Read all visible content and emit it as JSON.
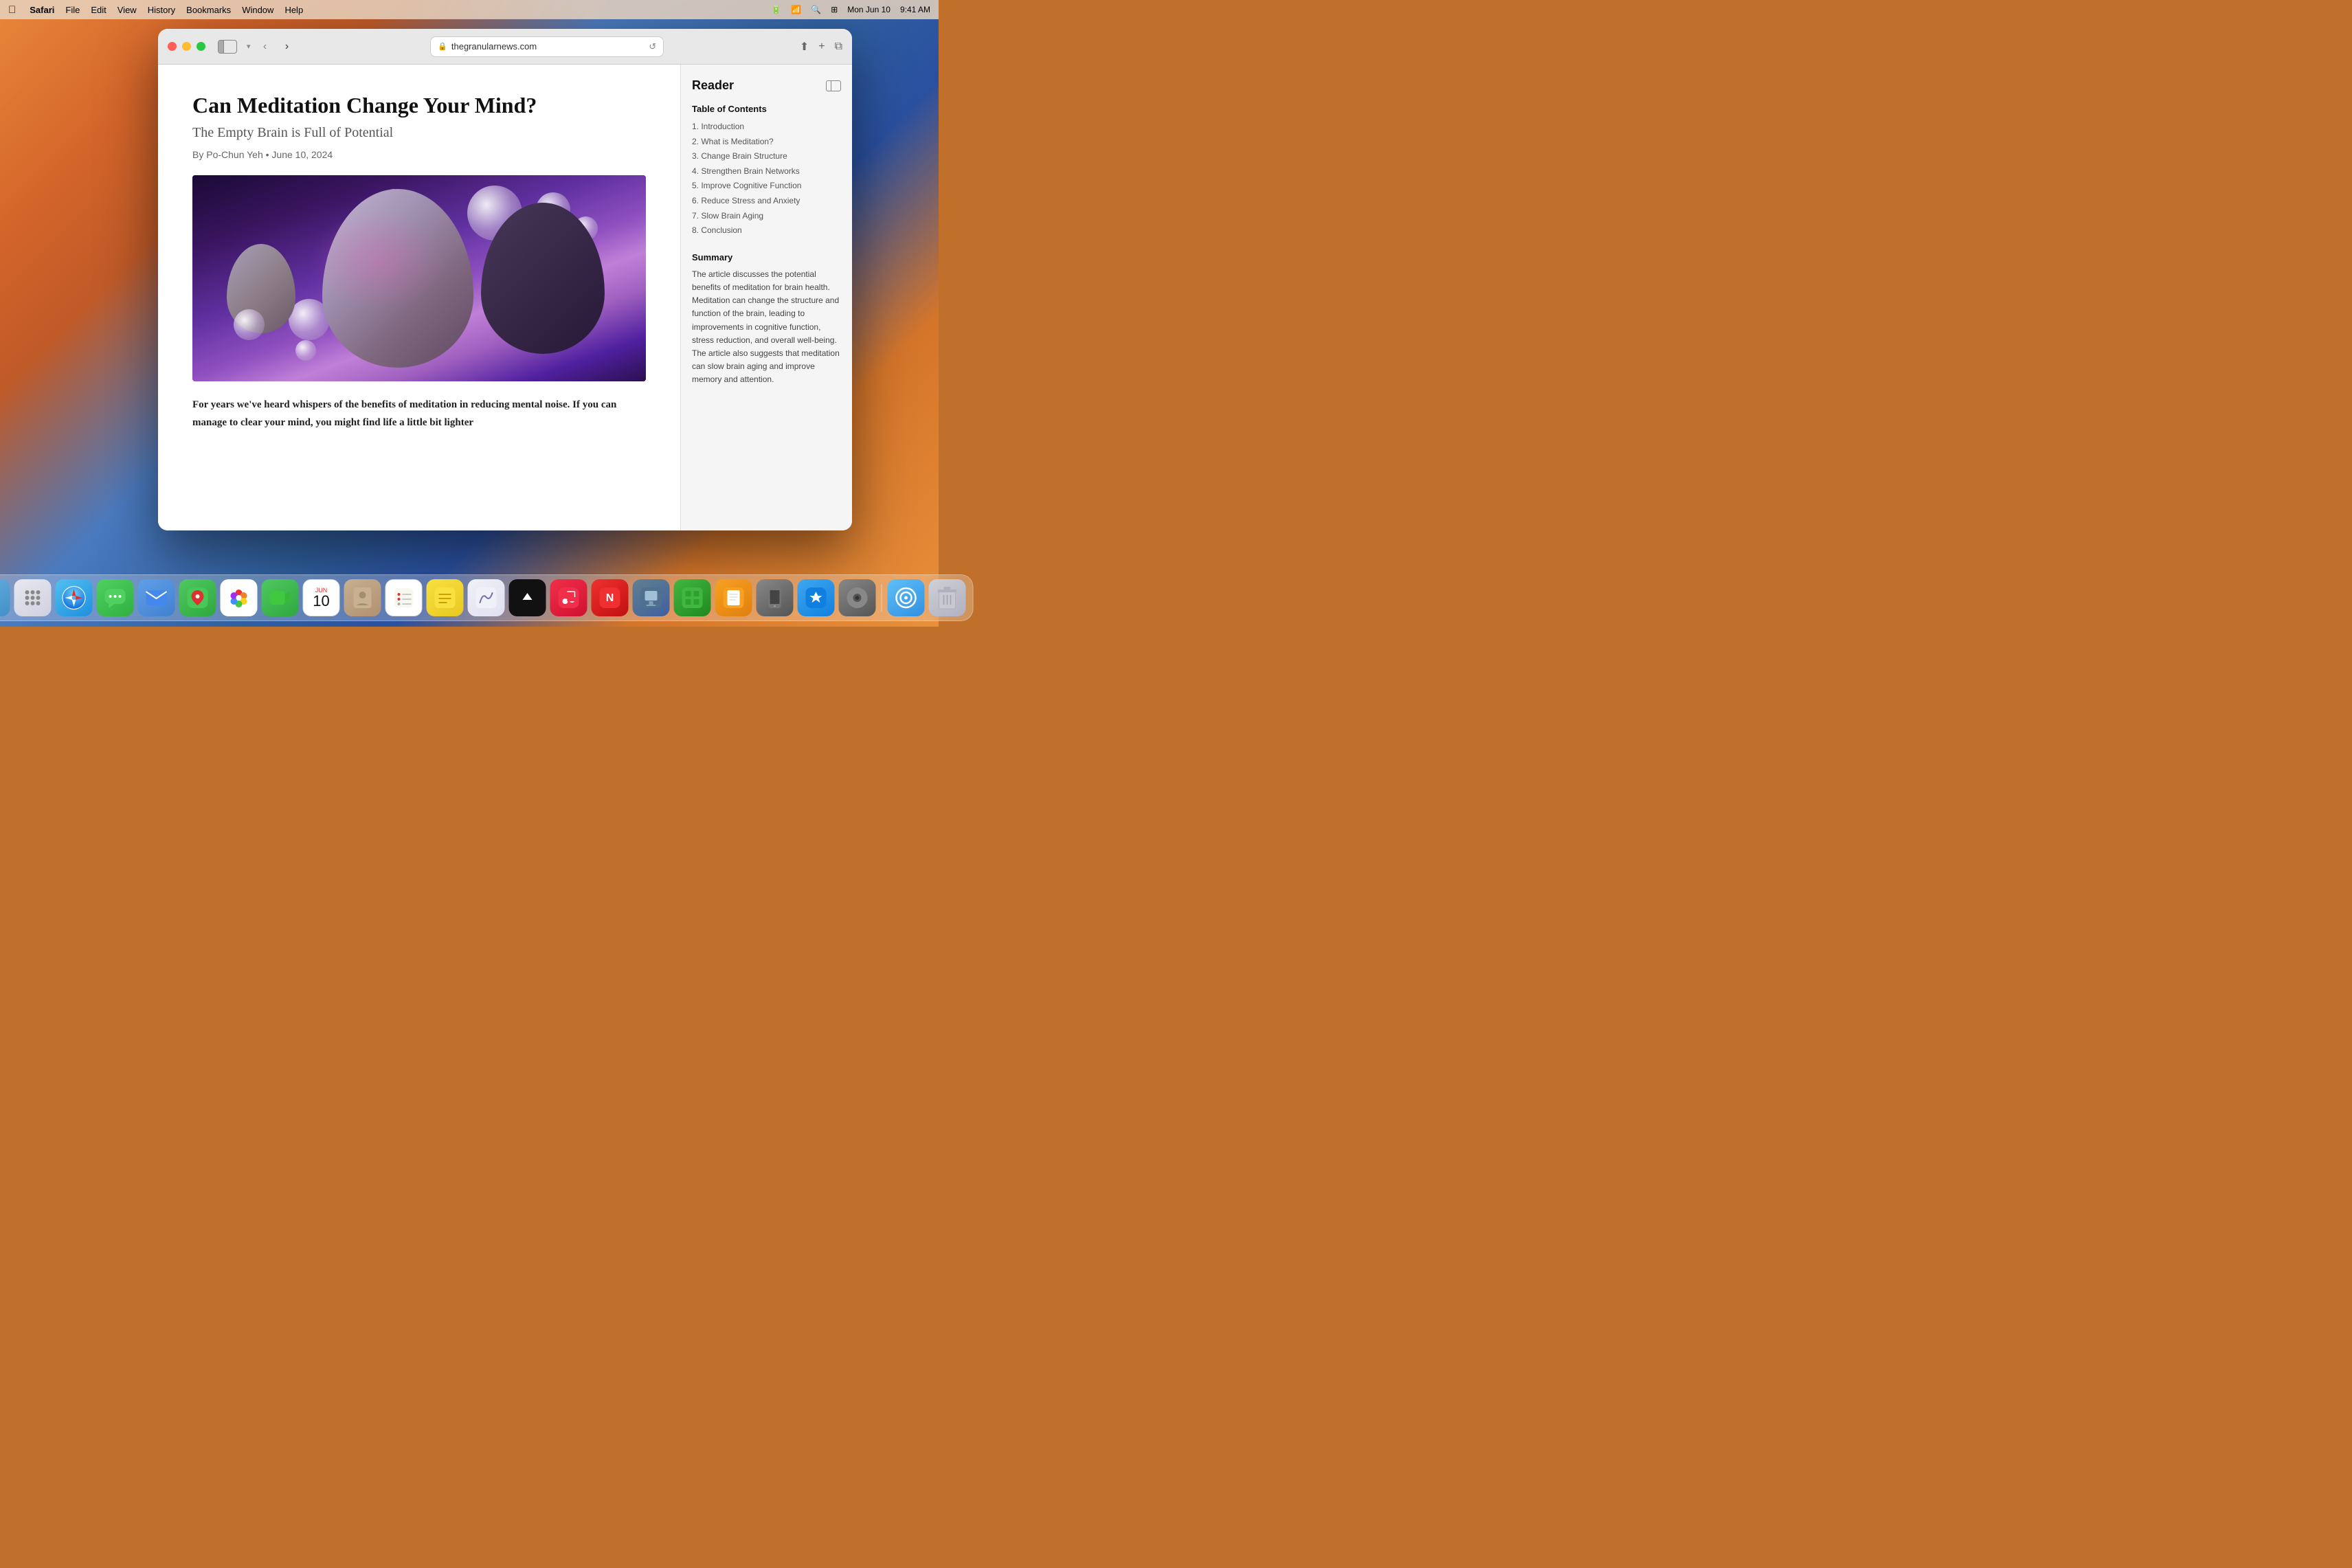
{
  "desktop": {
    "time": "9:41 AM",
    "date": "Mon Jun 10"
  },
  "menubar": {
    "apple": "🍎",
    "items": [
      "Safari",
      "File",
      "Edit",
      "View",
      "History",
      "Bookmarks",
      "Window",
      "Help"
    ]
  },
  "safari": {
    "url": "thegranularnews.com",
    "reader_label": "Reader",
    "toolbar": {
      "back": "‹",
      "forward": "›",
      "share": "⬆",
      "new_tab": "+",
      "tab_overview": "⧉",
      "reload": "↺"
    }
  },
  "article": {
    "title": "Can Meditation Change Your Mind?",
    "subtitle": "The Empty Brain is Full of Potential",
    "byline": "By Po-Chun Yeh  •  June 10, 2024",
    "body_start": "For years we've heard whispers of the benefits of meditation in reducing mental noise. If you can manage to clear your mind, you might find life a little bit lighter"
  },
  "reader": {
    "title": "Reader",
    "toc_title": "Table of Contents",
    "toc_items": [
      "1. Introduction",
      "2. What is Meditation?",
      "3. Change Brain Structure",
      "4. Strengthen Brain Networks",
      "5. Improve Cognitive Function",
      "6. Reduce Stress and Anxiety",
      "7. Slow Brain Aging",
      "8. Conclusion"
    ],
    "summary_title": "Summary",
    "summary_text": "The article discusses the potential benefits of meditation for brain health. Meditation can change the structure and function of the brain, leading to improvements in cognitive function, stress reduction, and overall well-being. The article also suggests that meditation can slow brain aging and improve memory and attention."
  },
  "dock": {
    "calendar_month": "JUN",
    "calendar_day": "10",
    "apps": [
      {
        "name": "Finder",
        "class": "dock-finder"
      },
      {
        "name": "Launchpad",
        "class": "dock-launchpad"
      },
      {
        "name": "Safari",
        "class": "dock-safari"
      },
      {
        "name": "Messages",
        "class": "dock-messages"
      },
      {
        "name": "Mail",
        "class": "dock-mail"
      },
      {
        "name": "Maps",
        "class": "dock-maps"
      },
      {
        "name": "Photos",
        "class": "dock-photos"
      },
      {
        "name": "FaceTime",
        "class": "dock-facetime"
      },
      {
        "name": "Calendar",
        "class": "dock-calendar"
      },
      {
        "name": "Contacts",
        "class": "dock-contacts"
      },
      {
        "name": "Reminders",
        "class": "dock-reminders"
      },
      {
        "name": "Notes",
        "class": "dock-notes"
      },
      {
        "name": "Freeform",
        "class": "dock-freeform"
      },
      {
        "name": "Apple TV",
        "class": "dock-appletv"
      },
      {
        "name": "Music",
        "class": "dock-music"
      },
      {
        "name": "News",
        "class": "dock-news"
      },
      {
        "name": "Keynote",
        "class": "dock-keynote"
      },
      {
        "name": "Numbers",
        "class": "dock-numbers"
      },
      {
        "name": "Pages",
        "class": "dock-pages"
      },
      {
        "name": "Phone Mirroring",
        "class": "dock-mirroring"
      },
      {
        "name": "App Store",
        "class": "dock-appstore"
      },
      {
        "name": "System Preferences",
        "class": "dock-sysprefd"
      },
      {
        "name": "AirDrop",
        "class": "dock-airdrop"
      },
      {
        "name": "Trash",
        "class": "dock-trash"
      }
    ]
  }
}
